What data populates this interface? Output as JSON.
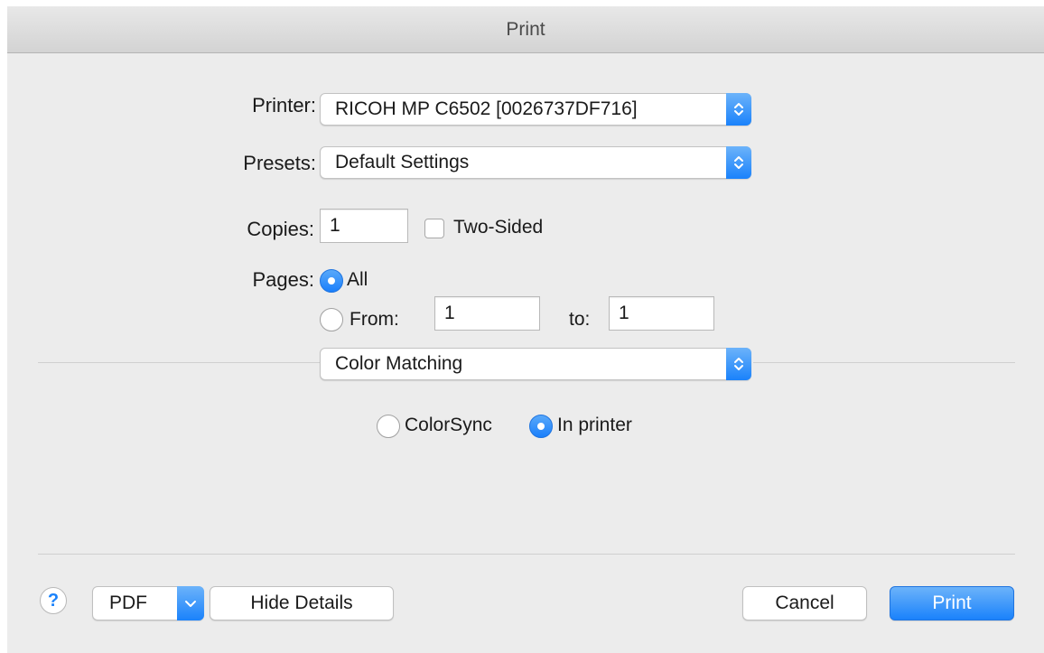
{
  "window": {
    "title": "Print"
  },
  "printer": {
    "label": "Printer:",
    "value": "RICOH MP C6502 [0026737DF716]"
  },
  "presets": {
    "label": "Presets:",
    "value": "Default Settings"
  },
  "copies": {
    "label": "Copies:",
    "value": "1",
    "two_sided_label": "Two-Sided",
    "two_sided_checked": false
  },
  "pages": {
    "label": "Pages:",
    "all_label": "All",
    "all_selected": true,
    "from_label": "From:",
    "from_value": "1",
    "to_label": "to:",
    "to_value": "1"
  },
  "section_popup": {
    "value": "Color Matching"
  },
  "color_matching": {
    "colorsync_label": "ColorSync",
    "in_printer_label": "In printer",
    "selected": "In printer"
  },
  "footer": {
    "help_label": "?",
    "pdf_label": "PDF",
    "hide_details_label": "Hide Details",
    "cancel_label": "Cancel",
    "print_label": "Print"
  },
  "colors": {
    "accent": "#1a82fb",
    "window_bg": "#ececec"
  }
}
